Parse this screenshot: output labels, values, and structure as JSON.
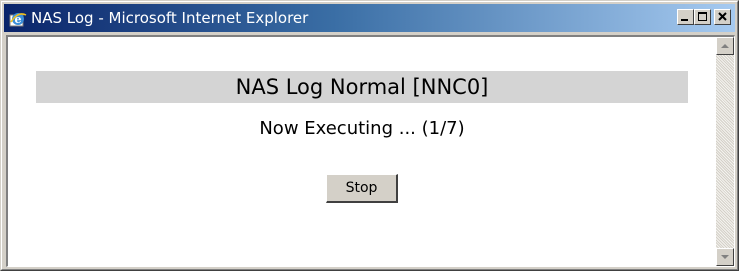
{
  "window": {
    "title": "NAS Log - Microsoft Internet Explorer",
    "icon": "internet-explorer-icon"
  },
  "titlebar_buttons": {
    "minimize_icon": "minimize-icon",
    "maximize_icon": "maximize-icon",
    "close_icon": "close-icon"
  },
  "page": {
    "heading": "NAS Log Normal [NNC0]",
    "status": "Now Executing ... (1/7)",
    "stop_label": "Stop"
  },
  "scrollbar": {
    "up_icon": "scroll-up-arrow-icon",
    "down_icon": "scroll-down-arrow-icon"
  },
  "colors": {
    "titlebar_start": "#0a246a",
    "titlebar_end": "#a6caf0",
    "heading_bg": "#d4d4d4",
    "chrome": "#d4d0c8"
  }
}
